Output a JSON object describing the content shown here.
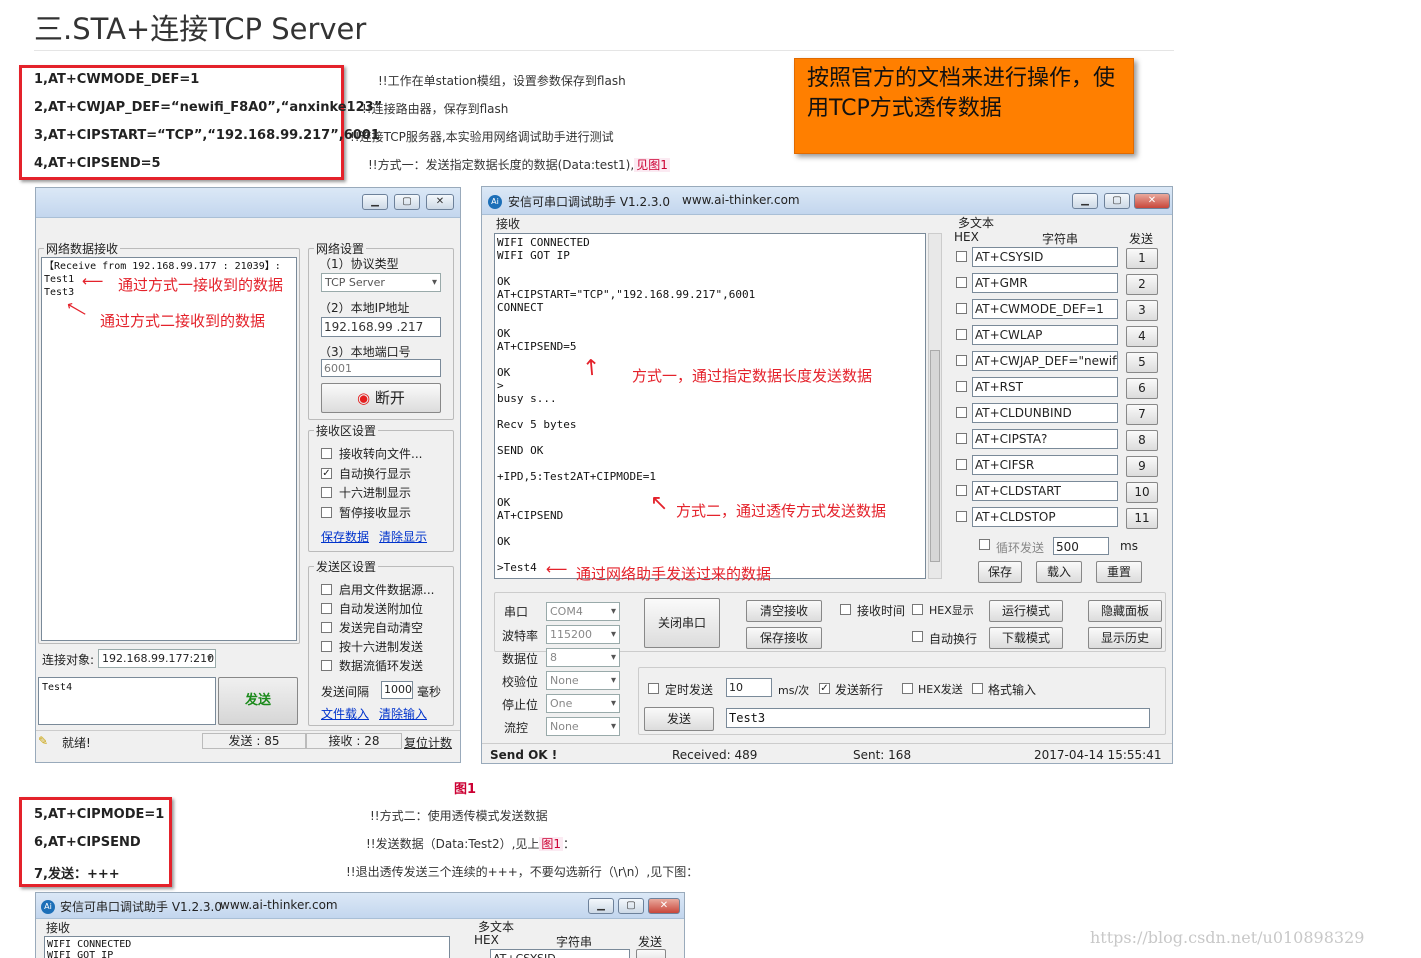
{
  "heading": "三.STA+连接TCP Server",
  "steps1": [
    {
      "cmd": "1,AT+CWMODE_DEF=1",
      "note": "!!工作在单station模组，设置参数保存到flash"
    },
    {
      "cmd": "2,AT+CWJAP_DEF=“newifi_F8A0”,“anxinke123”",
      "note": "!!连接路由器，保存到flash"
    },
    {
      "cmd": "3,AT+CIPSTART=“TCP”,“192.168.99.217”,6001",
      "note": "!!连接TCP服务器,本实验用网络调试助手进行测试"
    },
    {
      "cmd": "4,AT+CIPSEND=5",
      "note": "!!方式一：发送指定数据长度的数据(Data:test1),",
      "link": "见图1"
    }
  ],
  "orange_note": "按照官方的文档来进行操作，使用TCP方式透传数据",
  "nettool": {
    "recv_group": "网络数据接收",
    "recv_text": "【Receive from 192.168.99.177 : 21039】:\nTest1\nTest3",
    "net_group": "网络设置",
    "proto_label": "（1）协议类型",
    "proto_value": "TCP Server",
    "ip_label": "（2）本地IP地址",
    "ip_value": "192.168.99 .217",
    "port_label": "（3）本地端口号",
    "port_value": "6001",
    "disconnect": "断开",
    "recvset_group": "接收区设置",
    "recv_opts": [
      {
        "label": "接收转向文件...",
        "checked": false
      },
      {
        "label": "自动换行显示",
        "checked": true
      },
      {
        "label": "十六进制显示",
        "checked": false
      },
      {
        "label": "暂停接收显示",
        "checked": false
      }
    ],
    "save_data": "保存数据",
    "clear_display": "清除显示",
    "sendset_group": "发送区设置",
    "send_opts": [
      {
        "label": "启用文件数据源...",
        "checked": false
      },
      {
        "label": "自动发送附加位",
        "checked": false
      },
      {
        "label": "发送完自动清空",
        "checked": false
      },
      {
        "label": "按十六进制发送",
        "checked": false
      },
      {
        "label": "数据流循环发送",
        "checked": false
      }
    ],
    "interval_label": "发送间隔",
    "interval_value": "1000",
    "interval_unit": "毫秒",
    "file_load": "文件载入",
    "clear_input": "清除输入",
    "target_label": "连接对象:",
    "target_value": "192.168.99.177:210",
    "send_text": "Test4",
    "send_button": "发送",
    "status_ready": "就绪!",
    "status_sent": "发送 : 85",
    "status_recv": "接收 : 28",
    "reset_count": "复位计数",
    "ann1": "通过方式一接收到的数据",
    "ann2": "通过方式二接收到的数据"
  },
  "serial": {
    "title": "安信可串口调试助手 V1.2.3.0",
    "url": "www.ai-thinker.com",
    "recv_label": "接收",
    "recv_text": "WIFI CONNECTED\nWIFI GOT IP\n\nOK\nAT+CIPSTART=\"TCP\",\"192.168.99.217\",6001\nCONNECT\n\nOK\nAT+CIPSEND=5\n\nOK\n>\nbusy s...\n\nRecv 5 bytes\n\nSEND OK\n\n+IPD,5:Test2AT+CIPMODE=1\n\nOK\nAT+CIPSEND\n\nOK\n\n>Test4",
    "ann1": "方式一，通过指定数据长度发送数据",
    "ann2": "方式二，通过透传方式发送数据",
    "ann3": "通过网络助手发送过来的数据",
    "multi_label": "多文本",
    "col_hex": "HEX",
    "col_str": "字符串",
    "col_send": "发送",
    "multi_items": [
      "AT+CSYSID",
      "AT+GMR",
      "AT+CWMODE_DEF=1",
      "AT+CWLAP",
      "AT+CWJAP_DEF=\"newifi_",
      "AT+RST",
      "AT+CLDUNBIND",
      "AT+CIPSTA?",
      "AT+CIFSR",
      "AT+CLDSTART",
      "AT+CLDSTOP"
    ],
    "multi_nums": [
      "1",
      "2",
      "3",
      "4",
      "5",
      "6",
      "7",
      "8",
      "9",
      "10",
      "11"
    ],
    "loop_label": "循环发送",
    "loop_value": "500",
    "loop_unit": "ms",
    "save": "保存",
    "load": "载入",
    "reset": "重置",
    "port_label": "串口",
    "port_value": "COM4",
    "baud_label": "波特率",
    "baud_value": "115200",
    "data_label": "数据位",
    "data_value": "8",
    "parity_label": "校验位",
    "parity_value": "None",
    "stop_label": "停止位",
    "stop_value": "One",
    "flow_label": "流控",
    "flow_value": "None",
    "close_port": "关闭串口",
    "clear_recv": "清空接收",
    "save_recv": "保存接收",
    "recv_time": "接收时间",
    "hex_display": "HEX显示",
    "auto_wrap": "自动换行",
    "run_mode": "运行模式",
    "download_mode": "下载模式",
    "hide_panel": "隐藏面板",
    "show_history": "显示历史",
    "timed_send": "定时发送",
    "timed_value": "10",
    "timed_unit": "ms/次",
    "send_newline": "发送新行",
    "hex_send": "HEX发送",
    "format_input": "格式输入",
    "send": "发送",
    "send_input": "Test3",
    "status_ok": "Send OK !",
    "status_recv": "Received: 489",
    "status_sent": "Sent: 168",
    "status_time": "2017-04-14 15:55:41"
  },
  "fig_caption": "图1",
  "steps2": [
    {
      "cmd": "5,AT+CIPMODE=1",
      "note": "!!方式二：使用透传模式发送数据"
    },
    {
      "cmd": "6,AT+CIPSEND",
      "note": "!!发送数据（Data:Test2）,见上",
      "link": "图1",
      "tail": "："
    },
    {
      "cmd": "7,发送：+++",
      "note": "!!退出透传发送三个连续的+++，不要勾选新行（\\r\\n）,见下图："
    }
  ],
  "serial2": {
    "title": "安信可串口调试助手 V1.2.3.0",
    "url": "www.ai-thinker.com",
    "recv_label": "接收",
    "recv_text": "WIFI CONNECTED\nWIFI GOT IP",
    "multi_label": "多文本",
    "col_hex": "HEX",
    "col_str": "字符串",
    "col_send": "发送",
    "first_item": "AT+CSYSID"
  },
  "watermark": "https://blog.csdn.net/u010898329"
}
